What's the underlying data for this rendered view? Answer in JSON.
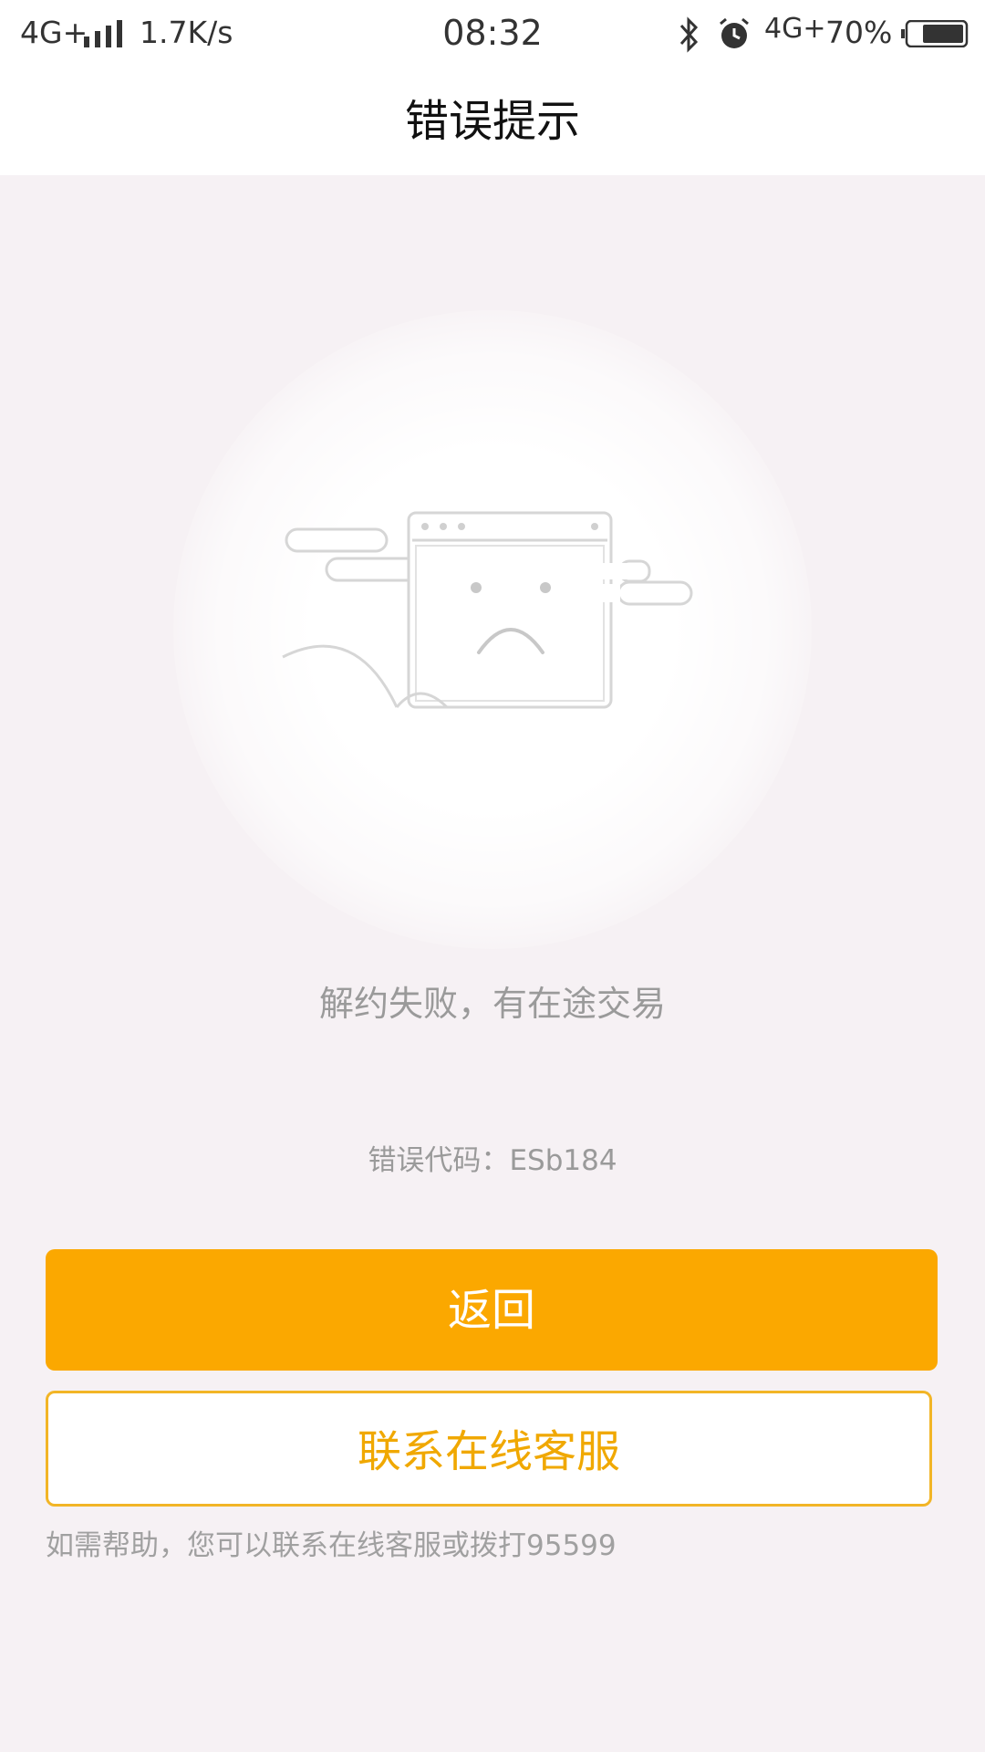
{
  "status_bar": {
    "network_left": "4G+",
    "speed": "1.7K/s",
    "time": "08:32",
    "network_right": "4G+",
    "battery": "70%",
    "icons": [
      "signal-icon",
      "bluetooth-icon",
      "alarm-icon",
      "battery-icon"
    ]
  },
  "nav": {
    "title": "错误提示"
  },
  "illustration": {
    "icon": "sad-browser-window-icon"
  },
  "error": {
    "message": "解约失败，有在途交易",
    "code_label": "错误代码：",
    "code_value": "ESb184"
  },
  "actions": {
    "back_label": "返回",
    "contact_label": "联系在线客服"
  },
  "help": {
    "text": "如需帮助，您可以联系在线客服或拨打95599"
  },
  "colors": {
    "accent": "#fba800",
    "background": "#f6f1f4",
    "muted_text": "#9a9a9a"
  }
}
